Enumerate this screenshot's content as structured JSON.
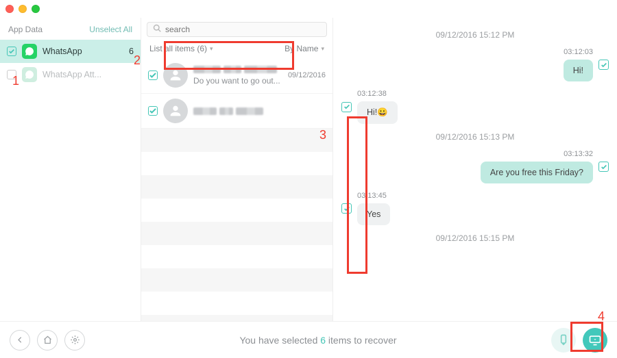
{
  "left": {
    "header_label": "App Data",
    "unselect_label": "Unselect All",
    "items": [
      {
        "name": "WhatsApp",
        "count": "6",
        "checked": true,
        "selected": true,
        "dimmed": false
      },
      {
        "name": "WhatsApp Att...",
        "count": "",
        "checked": false,
        "selected": false,
        "dimmed": true
      }
    ]
  },
  "mid": {
    "search_placeholder": "search",
    "list_label": "List all items (6)",
    "sort_label": "By Name",
    "conversations": [
      {
        "preview": "Do you want to go out...",
        "date": "09/12/2016",
        "selected": true
      },
      {
        "preview": "",
        "date": "",
        "selected": false
      }
    ]
  },
  "chat": {
    "groups": [
      {
        "day": "09/12/2016 15:12 PM",
        "messages": [
          {
            "dir": "out",
            "time": "03:12:03",
            "text": "Hi!"
          },
          {
            "dir": "in",
            "time": "03:12:38",
            "text": "Hi!😀"
          }
        ]
      },
      {
        "day": "09/12/2016 15:13 PM",
        "messages": [
          {
            "dir": "out",
            "time": "03:13:32",
            "text": "Are you free this Friday?"
          },
          {
            "dir": "in",
            "time": "03:13:45",
            "text": "Yes"
          }
        ]
      },
      {
        "day": "09/12/2016 15:15 PM",
        "messages": []
      }
    ]
  },
  "footer": {
    "text_pre": "You have selected ",
    "count": "6",
    "text_post": " items to recover"
  },
  "annotations": [
    "1",
    "2",
    "3",
    "4"
  ]
}
